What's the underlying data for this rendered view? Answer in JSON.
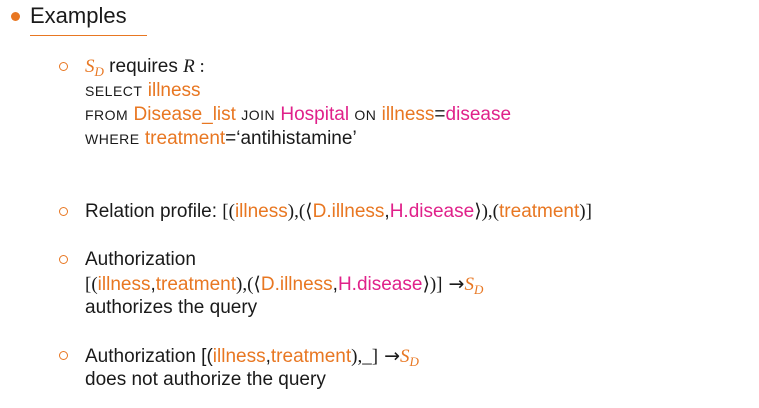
{
  "heading": "Examples",
  "item1": {
    "s": "S",
    "s_sub": "D",
    "requires": " requires ",
    "r": "R",
    "colon": " :",
    "select_kw": "SELECT",
    "select_attr": "illness",
    "from_kw": "FROM",
    "from_table1": "Disease_list",
    "join_kw": "JOIN",
    "from_table2": "Hospital",
    "on_kw": "ON",
    "on_left": "illness",
    "eq": "=",
    "on_right": "disease",
    "where_kw": "WHERE",
    "where_attr": "treatment",
    "where_value": "=‘antihistamine’"
  },
  "item2": {
    "label": "Relation profile: ",
    "p1": "[(",
    "a1": "illness",
    "p2": "),(⟨",
    "d_illness": "D.illness",
    "comma": ",",
    "h_disease": "H.disease",
    "p3": "⟩),(",
    "a2": "treatment",
    "p4": ")]"
  },
  "item3": {
    "label": "Authorization",
    "p1": "[(",
    "a1": "illness",
    "comma1": ",",
    "a2": "treatment",
    "p2": "),(⟨",
    "d_illness": "D.illness",
    "comma2": ",",
    "h_disease": "H.disease",
    "p3": "⟩)]",
    "arrow": " →",
    "s": "S",
    "s_sub": "D",
    "conclusion": "authorizes the query"
  },
  "item4": {
    "label": "Authorization [(",
    "a1": "illness",
    "comma": ",",
    "a2": "treatment",
    "p2": "),_]",
    "arrow": " →",
    "s": "S",
    "s_sub": "D",
    "conclusion": "does not authorize the query"
  }
}
